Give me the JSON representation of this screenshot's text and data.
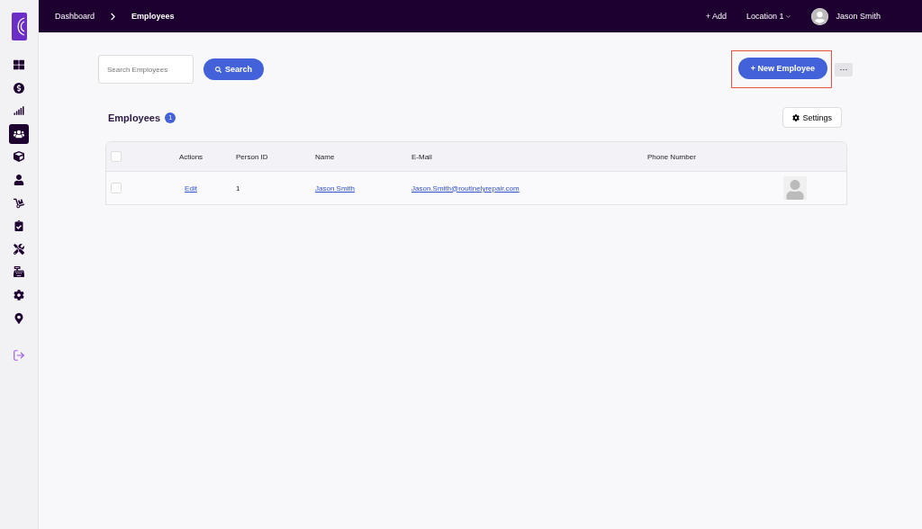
{
  "sidebar": {
    "items": [
      {
        "kind": "dashboard",
        "selected": false
      },
      {
        "kind": "money",
        "selected": false
      },
      {
        "kind": "chart",
        "selected": false
      },
      {
        "kind": "people",
        "selected": true
      },
      {
        "kind": "box",
        "selected": false
      },
      {
        "kind": "person",
        "selected": false
      },
      {
        "kind": "dolly",
        "selected": false
      },
      {
        "kind": "clipboard",
        "selected": false
      },
      {
        "kind": "tools",
        "selected": false
      },
      {
        "kind": "register",
        "selected": false
      },
      {
        "kind": "settings",
        "selected": false
      },
      {
        "kind": "location",
        "selected": false
      }
    ],
    "logout": {
      "kind": "logout"
    }
  },
  "breadcrumb": [
    {
      "label": "Dashboard",
      "current": false
    },
    {
      "label": "Employees",
      "current": true
    }
  ],
  "topbar": {
    "add": "+ Add",
    "location": "Location 1",
    "user": "Jason Smith"
  },
  "search": {
    "placeholder": "Search Employees",
    "button": "Search"
  },
  "new_button": {
    "label": "+ New Employee",
    "highlighted": true
  },
  "more_button": "···",
  "section": {
    "title": "Employees",
    "count": "1",
    "settings": "Settings"
  },
  "table": {
    "all_checked": false,
    "columns": [
      "Actions",
      "Person ID",
      "Name",
      "E-Mail",
      "Phone Number"
    ],
    "rows": [
      {
        "checked": false,
        "action": "Edit",
        "id": "1",
        "name": "Jason Smith",
        "email": "Jason.Smith@routinelyrepair.com"
      }
    ]
  }
}
